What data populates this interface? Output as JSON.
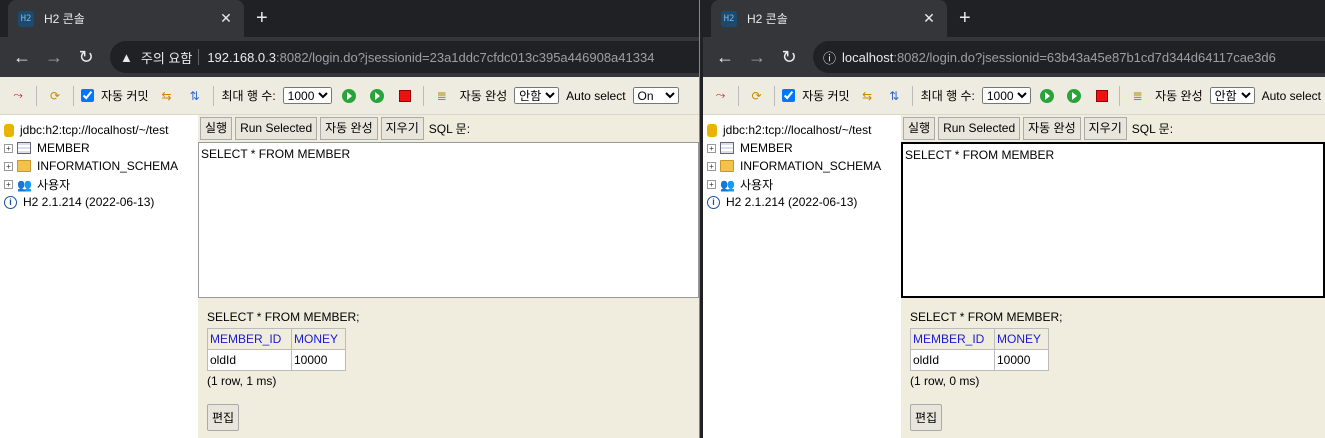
{
  "left": {
    "tab_title": "H2 콘솔",
    "omnibox": {
      "security": "주의 요함",
      "host": "192.168.0.3",
      "rest": ":8082/login.do?jsessionid=23a1ddc7cfdc013c395a446908a41334"
    },
    "toolbar": {
      "autocommit": "자동 커밋",
      "maxrows_label": "최대 행 수:",
      "maxrows": "1000",
      "autocomplete_label": "자동 완성",
      "autocomplete": "안함",
      "autoselect_label": "Auto select",
      "autoselect": "On"
    },
    "tree": {
      "connection": "jdbc:h2:tcp://localhost/~/test",
      "items": [
        "MEMBER",
        "INFORMATION_SCHEMA",
        "사용자"
      ],
      "version": "H2 2.1.214 (2022-06-13)"
    },
    "sqlbar": {
      "run": "실행",
      "run_selected": "Run Selected",
      "autocomplete": "자동 완성",
      "clear": "지우기",
      "sql_label": "SQL 문:"
    },
    "editor": "SELECT * FROM MEMBER",
    "result": {
      "query": "SELECT * FROM MEMBER;",
      "columns": [
        "MEMBER_ID",
        "MONEY"
      ],
      "rows": [
        [
          "oldId",
          "10000"
        ]
      ],
      "rowinfo": "(1 row, 1 ms)",
      "edit": "편집"
    }
  },
  "right": {
    "tab_title": "H2 콘솔",
    "omnibox": {
      "host": "localhost",
      "rest": ":8082/login.do?jsessionid=63b43a45e87b1cd7d344d64117cae3d6"
    },
    "toolbar": {
      "autocommit": "자동 커밋",
      "maxrows_label": "최대 행 수:",
      "maxrows": "1000",
      "autocomplete_label": "자동 완성",
      "autocomplete": "안함",
      "autoselect_label": "Auto select"
    },
    "tree": {
      "connection": "jdbc:h2:tcp://localhost/~/test",
      "items": [
        "MEMBER",
        "INFORMATION_SCHEMA",
        "사용자"
      ],
      "version": "H2 2.1.214 (2022-06-13)"
    },
    "sqlbar": {
      "run": "실행",
      "run_selected": "Run Selected",
      "autocomplete": "자동 완성",
      "clear": "지우기",
      "sql_label": "SQL 문:"
    },
    "editor": "SELECT * FROM MEMBER",
    "result": {
      "query": "SELECT * FROM MEMBER;",
      "columns": [
        "MEMBER_ID",
        "MONEY"
      ],
      "rows": [
        [
          "oldId",
          "10000"
        ]
      ],
      "rowinfo": "(1 row, 0 ms)",
      "edit": "편집"
    }
  },
  "icons": {
    "tab_favicon": "h2-favicon",
    "close": "close-icon",
    "new_tab": "plus-icon",
    "back": "back-arrow-icon",
    "forward": "forward-arrow-icon",
    "reload": "reload-icon"
  },
  "colors": {
    "chrome_dark": "#202124",
    "chrome_toolbar": "#35363a",
    "h2_bg": "#f0eddf",
    "link_blue": "#1a1ad4"
  }
}
